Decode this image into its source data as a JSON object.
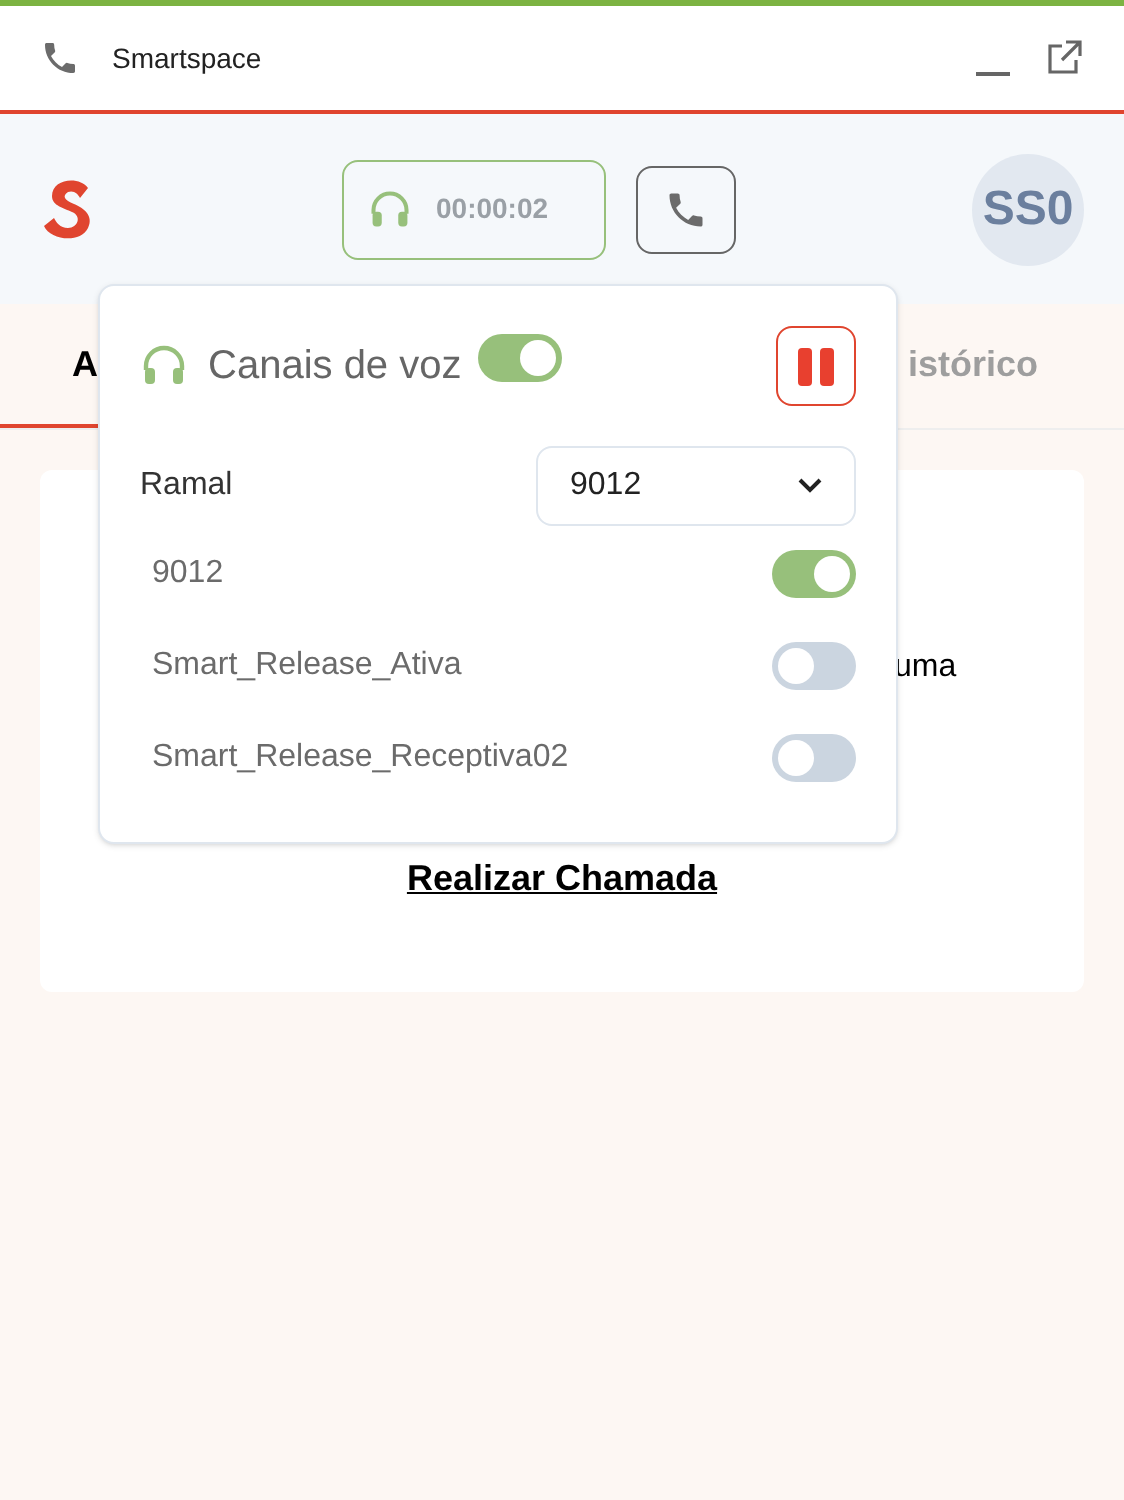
{
  "window": {
    "title": "Smartspace"
  },
  "header": {
    "timer": "00:00:02",
    "avatar": "SS0"
  },
  "tabs": [
    {
      "label": "A",
      "selected": true
    },
    {
      "label": "istórico",
      "selected": false
    }
  ],
  "card": {
    "text": "uma",
    "link": "Realizar Chamada"
  },
  "popover": {
    "title": "Canais de voz",
    "voice_on": true,
    "ramal_label": "Ramal",
    "ramal_value": "9012",
    "channels": [
      {
        "name": "9012",
        "on": true
      },
      {
        "name": "Smart_Release_Ativa",
        "on": false
      },
      {
        "name": "Smart_Release_Receptiva02",
        "on": false
      }
    ]
  }
}
